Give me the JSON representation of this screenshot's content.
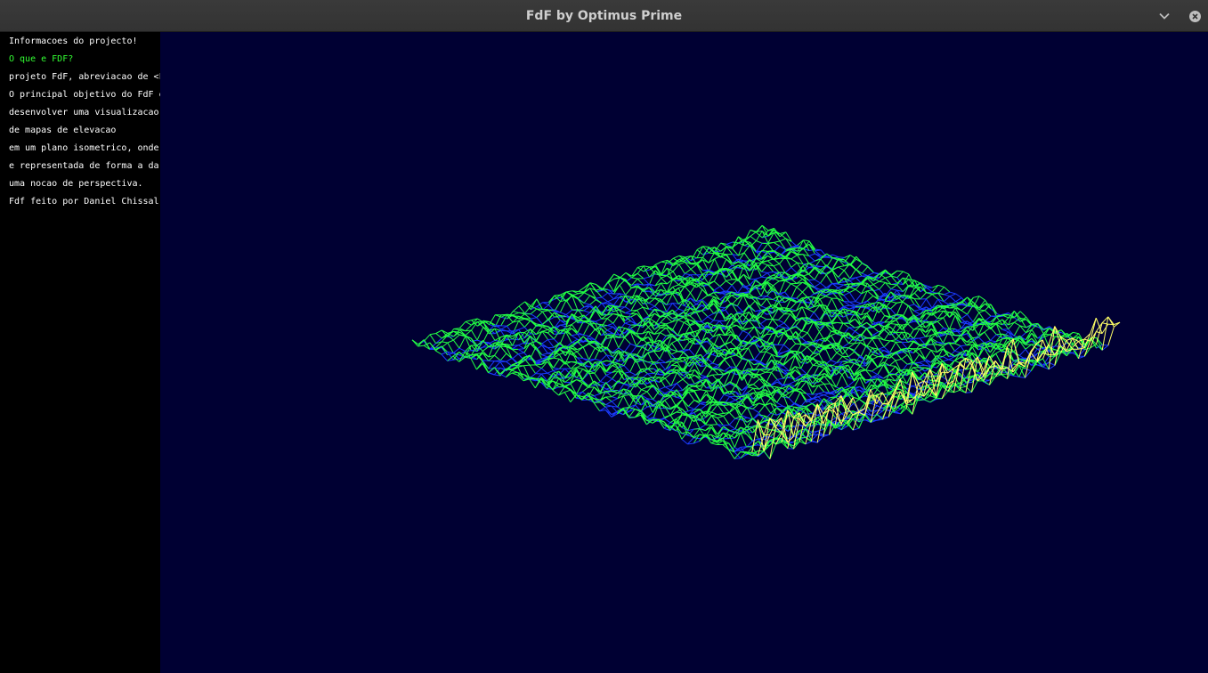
{
  "window": {
    "title": "FdF by Optimus Prime",
    "minimize_icon": "chevron-down-icon",
    "close_icon": "close-icon"
  },
  "sidebar": {
    "lines": [
      {
        "text": "Informacoes do projecto!",
        "color": "#ffffff"
      },
      {
        "text": "O que e FDF?",
        "color": "#33ff33"
      },
      {
        "text": "projeto FdF, abreviacao de <F",
        "color": "#ffffff"
      },
      {
        "text": "O principal objetivo do FdF e",
        "color": "#ffffff"
      },
      {
        "text": "desenvolver uma visualizacao",
        "color": "#ffffff"
      },
      {
        "text": "de mapas de elevacao",
        "color": "#ffffff"
      },
      {
        "text": "em um plano isometrico, onde",
        "color": "#ffffff"
      },
      {
        "text": "e representada de forma a dar",
        "color": "#ffffff"
      },
      {
        "text": "uma nocao de perspectiva.",
        "color": "#ffffff"
      },
      {
        "text": "Fdf feito por Daniel Chissal:",
        "color": "#ffffff"
      }
    ]
  },
  "viewport": {
    "background": "#000033",
    "colors": {
      "low": "#1a3cff",
      "mid": "#22ff44",
      "high": "#ffff66"
    }
  }
}
